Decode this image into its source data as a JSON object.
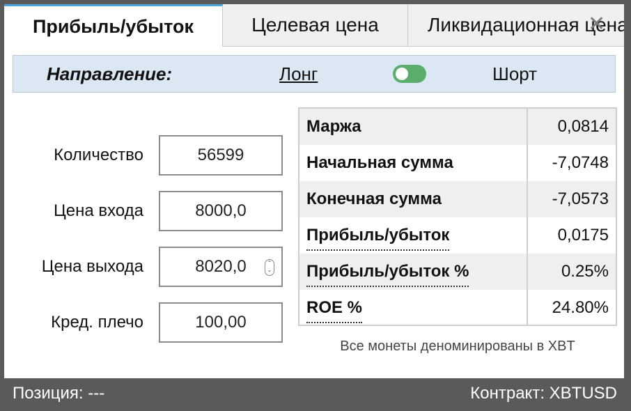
{
  "tabs": [
    {
      "label": "Прибыль/убыток",
      "active": true
    },
    {
      "label": "Целевая цена",
      "active": false
    },
    {
      "label": "Ликвидационная цена",
      "active": false
    }
  ],
  "close_icon": "close-icon",
  "direction": {
    "label": "Направление:",
    "long": "Лонг",
    "short": "Шорт",
    "toggle_color": "#5aad6a"
  },
  "fields": {
    "quantity": {
      "label": "Количество",
      "value": "56599"
    },
    "entry_price": {
      "label": "Цена входа",
      "value": "8000,0"
    },
    "exit_price": {
      "label": "Цена выхода",
      "value": "8020,0"
    },
    "leverage": {
      "label": "Кред. плечо",
      "value": "100,00"
    }
  },
  "results": [
    {
      "label": "Маржа",
      "value": "0,0814"
    },
    {
      "label": "Начальная сумма",
      "value": "-7,0748"
    },
    {
      "label": "Конечная сумма",
      "value": "-7,0573"
    },
    {
      "label": "Прибыль/убыток",
      "value": "0,0175"
    },
    {
      "label": "Прибыль/убыток %",
      "value": "0.25%"
    },
    {
      "label": "ROE %",
      "value": "24.80%"
    }
  ],
  "note": "Все монеты деноминированы в XBT",
  "status": {
    "position": "Позиция: ---",
    "contract": "Контракт: XBTUSD"
  }
}
